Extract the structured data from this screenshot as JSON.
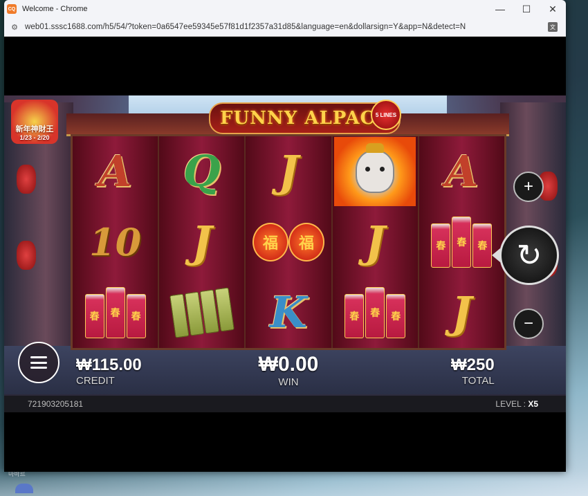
{
  "window": {
    "title": "Welcome - Chrome",
    "app_icon_text": "CQ",
    "controls": {
      "minimize": "—",
      "maximize": "☐",
      "close": "✕"
    }
  },
  "addressbar": {
    "url": "web01.sssc1688.com/h5/54/?token=0a6547ee59345e57f81d1f2357a31d85&language=en&dollarsign=Y&app=N&detect=N"
  },
  "game": {
    "title": "FUNNY ALPACA",
    "lines_badge": "5 LINES",
    "event_badge": {
      "title": "新年神財王",
      "dates": "1/23 - 2/20"
    },
    "reels": [
      [
        "A",
        "10",
        "firecracker"
      ],
      [
        "Q",
        "J",
        "slips"
      ],
      [
        "J",
        "lanterns",
        "K"
      ],
      [
        "alpaca",
        "J",
        "firecracker"
      ],
      [
        "A",
        "firecracker",
        "J"
      ]
    ],
    "symbols": {
      "lantern_char": "福",
      "firecracker_char": "春"
    },
    "credit": {
      "value": "₩115.00",
      "label": "CREDIT"
    },
    "win": {
      "value": "₩0.00",
      "label": "WIN"
    },
    "total": {
      "value": "₩250",
      "label": "TOTAL"
    },
    "footer": {
      "game_id": "721903205181",
      "level_label": "LEVEL : ",
      "level_value": "X5"
    },
    "buttons": {
      "plus": "+",
      "minus": "−",
      "spin": "↻"
    }
  },
  "desktop": {
    "text": "마바르"
  },
  "colors": {
    "accent_gold": "#f2c24a",
    "reel_red": "#8e1a3a"
  }
}
